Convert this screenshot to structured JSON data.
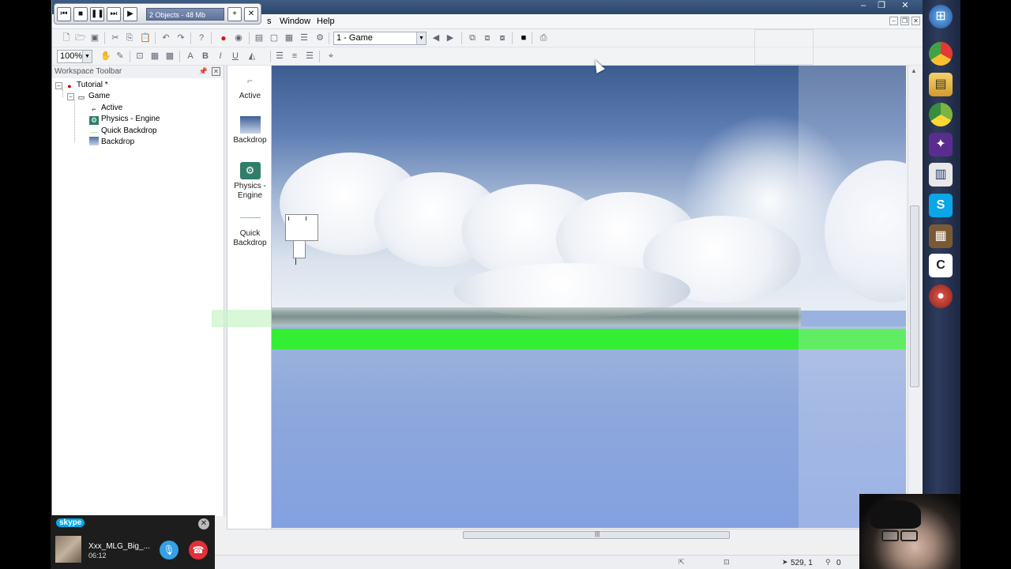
{
  "menu": {
    "frag": "s",
    "window": "Window",
    "help": "Help"
  },
  "recorder": {
    "status": "2 Objects - 48 Mb",
    "buttons": [
      "first-icon",
      "stop-icon",
      "pause-icon",
      "next-icon",
      "play-icon"
    ],
    "add": "+",
    "close": "✕"
  },
  "toolbar1": {
    "frame_select": "1 - Game"
  },
  "toolbar2": {
    "zoom": "100%",
    "bold": "B",
    "italic": "I",
    "underline": "U"
  },
  "workspace": {
    "title": "Workspace Toolbar",
    "tree": [
      {
        "label": "Tutorial *",
        "icon": "app-icon"
      },
      {
        "label": "Game",
        "icon": "frame-icon"
      },
      {
        "label": "Active",
        "icon": "active-object-icon"
      },
      {
        "label": "Physics - Engine",
        "icon": "physics-icon"
      },
      {
        "label": "Quick Backdrop",
        "icon": "quick-backdrop-icon"
      },
      {
        "label": "Backdrop",
        "icon": "backdrop-icon"
      }
    ]
  },
  "objects": [
    {
      "label": "Active",
      "icon": "active-object-icon"
    },
    {
      "label": "Backdrop",
      "icon": "backdrop-icon"
    },
    {
      "label": "Physics - Engine",
      "icon": "physics-icon"
    },
    {
      "label": "Quick Backdrop",
      "icon": "quick-backdrop-icon"
    }
  ],
  "status": {
    "coords": "529, 1",
    "count": "0"
  },
  "skype": {
    "logo": "skype",
    "name": "Xxx_MLG_Big_...",
    "time": "06:12"
  },
  "taskbar": [
    "windows-start-icon",
    "chrome-icon",
    "explorer-icon",
    "chrome-green-icon",
    "app-icon",
    "document-icon",
    "skype-icon",
    "minecraft-icon",
    "camtasia-icon",
    "recording-icon"
  ],
  "colors": {
    "ground": "#33ee33",
    "titlebar": "#2b4669",
    "skype_blue": "#00a9ec",
    "hangup_red": "#e2303a"
  }
}
